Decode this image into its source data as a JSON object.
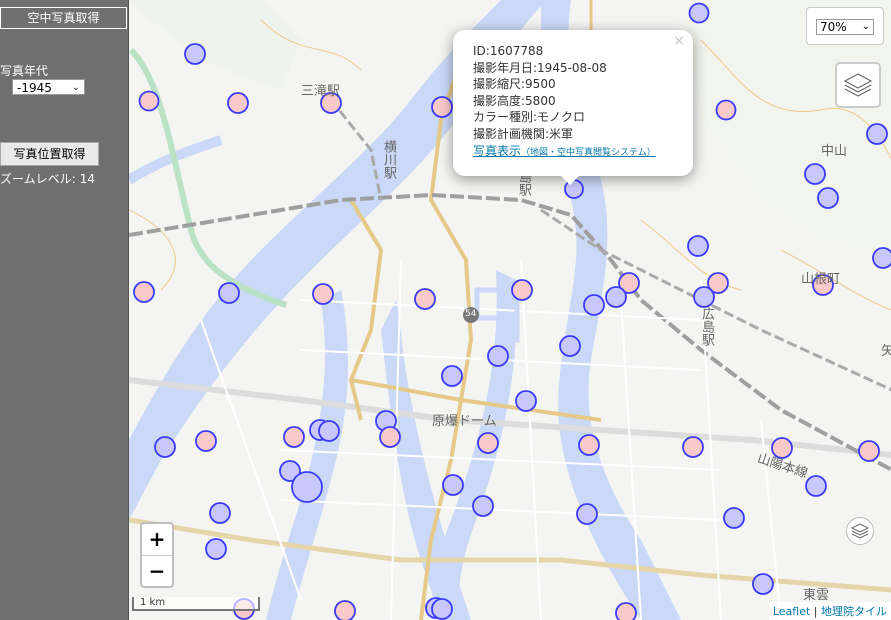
{
  "sidebar": {
    "title": "空中写真取得",
    "year_label": "写真年代",
    "year_value": "-1945",
    "get_button": "写真位置取得",
    "zoom_label": "ズームレベル:",
    "zoom_value": "14"
  },
  "map": {
    "labels": {
      "misaki": "三滝駅",
      "yokogawa": "横川駅",
      "hiroshima_partial": "島駅",
      "genbaku": "原爆ドーム",
      "nakayama": "中山",
      "yamane": "山根町",
      "hiroshima_station": "広島駅",
      "sanyo": "山陽本線",
      "higashikumo": "東雲",
      "route": "54",
      "edge": "矢"
    },
    "popup": {
      "close": "×",
      "id": "ID:1607788",
      "date": "撮影年月日:1945-08-08",
      "scale": "撮影縮尺:9500",
      "altitude": "撮影高度:5800",
      "color": "カラー種別:モノクロ",
      "agency": "撮影計画機関:米軍",
      "link_text": "写真表示",
      "link_sub": "（地図・空中写真閲覧システム）"
    },
    "opacity": "70%",
    "zoom_in": "+",
    "zoom_out": "−",
    "scale_label": "1 km",
    "attribution": {
      "leaflet": "Leaflet",
      "separator": " | ",
      "tile": "地理院タイル"
    },
    "colors": {
      "river": "#c9d9f7",
      "marker_stroke": "#3b3bff",
      "marker_blue_fill": "#c8c8ff",
      "marker_pink_fill": "#f7c9c9",
      "sidebar": "#6f6f6f",
      "link": "#0078a8"
    }
  }
}
